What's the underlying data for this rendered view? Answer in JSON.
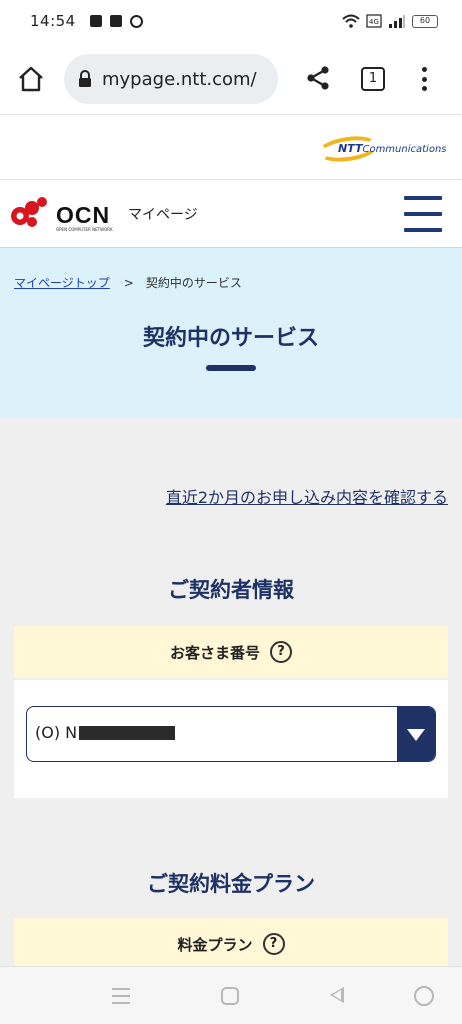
{
  "status_bar": {
    "time": "14:54",
    "battery": "60"
  },
  "browser": {
    "url": "mypage.ntt.com/",
    "tab_count": "1"
  },
  "brand": {
    "ntt_name": "NTT",
    "ntt_suffix": "Communications",
    "ocn_name": "OCN",
    "ocn_sub": "OPEN COMPUTER NETWORK",
    "site_label": "マイページ"
  },
  "breadcrumb": {
    "home": "マイページトップ",
    "separator": ">",
    "current": "契約中のサービス"
  },
  "page": {
    "title": "契約中のサービス"
  },
  "main": {
    "recent_link": "直近2か月のお申し込み内容を確認する",
    "contractor_heading": "ご契約者情報",
    "customer_number_label": "お客さま番号",
    "help_glyph": "?",
    "customer_select_value": "(O) N",
    "plan_heading": "ご契約料金プラン",
    "plan_label": "料金プラン"
  },
  "colors": {
    "navy": "#1e3266",
    "hero_bg": "#dbf2fa",
    "label_bg": "#fff7d6",
    "ntt_gold": "#f2b51b",
    "ocn_red": "#d7171f"
  },
  "icons": [
    "home-icon",
    "lock-icon",
    "share-icon",
    "more-vert-icon",
    "hamburger-icon",
    "help-icon",
    "dropdown-arrow-icon"
  ]
}
